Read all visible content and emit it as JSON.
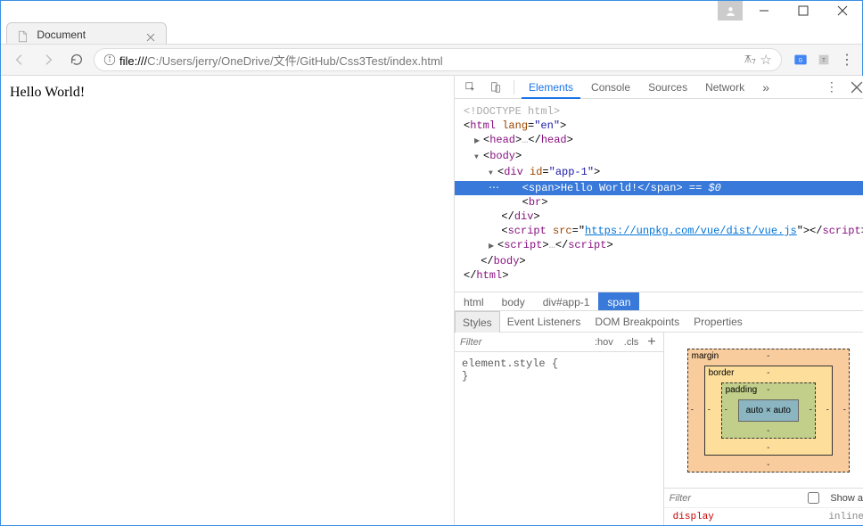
{
  "window": {
    "tab_title": "Document"
  },
  "toolbar": {
    "url_dark": "file:///",
    "url_rest": "C:/Users/jerry/OneDrive/文件/GitHub/Css3Test/index.html"
  },
  "page": {
    "content": "Hello World!"
  },
  "devtools": {
    "tabs": [
      "Elements",
      "Console",
      "Sources",
      "Network"
    ],
    "active_tab": 0,
    "tree": {
      "doctype": "<!DOCTYPE html>",
      "html_open": "html",
      "html_lang_attr": "lang",
      "html_lang_val": "\"en\"",
      "head": "head",
      "body": "body",
      "div": "div",
      "div_id_attr": "id",
      "div_id_val": "\"app-1\"",
      "span": "span",
      "span_text": "Hello World!",
      "span_suffix": " == $0",
      "br": "br",
      "script": "script",
      "script_src_attr": "src",
      "script_src_val": "https://unpkg.com/vue/dist/vue.js",
      "ellipsis": "…"
    },
    "crumbs": [
      "html",
      "body",
      "div#app-1",
      "span"
    ],
    "crumb_active": 3,
    "subtabs": [
      "Styles",
      "Event Listeners",
      "DOM Breakpoints",
      "Properties"
    ],
    "subtab_active": 0,
    "styles": {
      "filter_placeholder": "Filter",
      "hov": ":hov",
      "cls": ".cls",
      "rule_selector": "element.style {",
      "rule_close": "}"
    },
    "boxmodel": {
      "margin_label": "margin",
      "border_label": "border",
      "padding_label": "padding",
      "content": "auto × auto",
      "dash": "-"
    },
    "computed": {
      "filter_placeholder": "Filter",
      "showall_label": "Show all",
      "prop": "display",
      "val": "inline"
    }
  }
}
